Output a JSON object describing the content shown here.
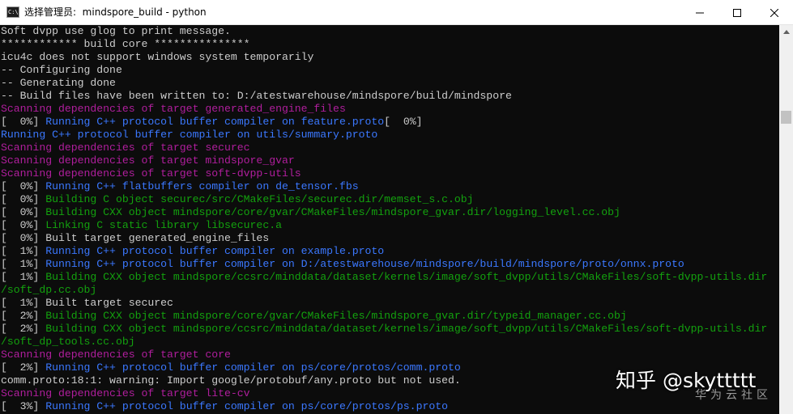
{
  "window": {
    "icon_text": "C:\\",
    "title": "选择管理员:  mindspore_build - python",
    "colors": {
      "background": "#0c0c0c",
      "titlebar": "#ffffff",
      "scrollbar": "#f0f0f0"
    }
  },
  "terminal": {
    "colors": {
      "white": "#cccccc",
      "magenta": "#b01e9d",
      "blue": "#3b78ff",
      "green": "#13a10e"
    },
    "lines": [
      {
        "segments": [
          {
            "text": "Soft dvpp use glog to print message.",
            "color": "white"
          }
        ]
      },
      {
        "segments": [
          {
            "text": "************ build core ***************",
            "color": "white"
          }
        ]
      },
      {
        "segments": [
          {
            "text": "icu4c does not support windows system temporarily",
            "color": "white"
          }
        ]
      },
      {
        "segments": [
          {
            "text": "-- Configuring done",
            "color": "white"
          }
        ]
      },
      {
        "segments": [
          {
            "text": "-- Generating done",
            "color": "white"
          }
        ]
      },
      {
        "segments": [
          {
            "text": "-- Build files have been written to: D:/atestwarehouse/mindspore/build/mindspore",
            "color": "white"
          }
        ]
      },
      {
        "segments": [
          {
            "text": "Scanning dependencies of target generated_engine_files",
            "color": "magenta"
          }
        ]
      },
      {
        "segments": [
          {
            "text": "[  0%] ",
            "color": "white"
          },
          {
            "text": "Running C++ protocol buffer compiler on feature.proto",
            "color": "blue"
          },
          {
            "text": "[  0%]",
            "color": "white"
          }
        ]
      },
      {
        "segments": [
          {
            "text": "Running C++ protocol buffer compiler on utils/summary.proto",
            "color": "blue"
          }
        ]
      },
      {
        "segments": [
          {
            "text": "Scanning dependencies of target securec",
            "color": "magenta"
          }
        ]
      },
      {
        "segments": [
          {
            "text": "Scanning dependencies of target mindspore_gvar",
            "color": "magenta"
          }
        ]
      },
      {
        "segments": [
          {
            "text": "Scanning dependencies of target soft-dvpp-utils",
            "color": "magenta"
          }
        ]
      },
      {
        "segments": [
          {
            "text": "[  0%] ",
            "color": "white"
          },
          {
            "text": "Running C++ flatbuffers compiler on de_tensor.fbs",
            "color": "blue"
          }
        ]
      },
      {
        "segments": [
          {
            "text": "[  0%] ",
            "color": "white"
          },
          {
            "text": "Building C object securec/src/CMakeFiles/securec.dir/memset_s.c.obj",
            "color": "green"
          }
        ]
      },
      {
        "segments": [
          {
            "text": "[  0%] ",
            "color": "white"
          },
          {
            "text": "Building CXX object mindspore/core/gvar/CMakeFiles/mindspore_gvar.dir/logging_level.cc.obj",
            "color": "green"
          }
        ]
      },
      {
        "segments": [
          {
            "text": "[  0%] ",
            "color": "white"
          },
          {
            "text": "Linking C static library libsecurec.a",
            "color": "green"
          }
        ]
      },
      {
        "segments": [
          {
            "text": "[  0%] Built target generated_engine_files",
            "color": "white"
          }
        ]
      },
      {
        "segments": [
          {
            "text": "[  1%] ",
            "color": "white"
          },
          {
            "text": "Running C++ protocol buffer compiler on example.proto",
            "color": "blue"
          }
        ]
      },
      {
        "segments": [
          {
            "text": "[  1%] ",
            "color": "white"
          },
          {
            "text": "Running C++ protocol buffer compiler on D:/atestwarehouse/mindspore/build/mindspore/proto/onnx.proto",
            "color": "blue"
          }
        ]
      },
      {
        "segments": [
          {
            "text": "[  1%] ",
            "color": "white"
          },
          {
            "text": "Building CXX object mindspore/ccsrc/minddata/dataset/kernels/image/soft_dvpp/utils/CMakeFiles/soft-dvpp-utils.dir",
            "color": "green"
          }
        ]
      },
      {
        "segments": [
          {
            "text": "/soft_dp.cc.obj",
            "color": "green"
          }
        ]
      },
      {
        "segments": [
          {
            "text": "[  1%] Built target securec",
            "color": "white"
          }
        ]
      },
      {
        "segments": [
          {
            "text": "[  2%] ",
            "color": "white"
          },
          {
            "text": "Building CXX object mindspore/core/gvar/CMakeFiles/mindspore_gvar.dir/typeid_manager.cc.obj",
            "color": "green"
          }
        ]
      },
      {
        "segments": [
          {
            "text": "[  2%] ",
            "color": "white"
          },
          {
            "text": "Building CXX object mindspore/ccsrc/minddata/dataset/kernels/image/soft_dvpp/utils/CMakeFiles/soft-dvpp-utils.dir",
            "color": "green"
          }
        ]
      },
      {
        "segments": [
          {
            "text": "/soft_dp_tools.cc.obj",
            "color": "green"
          }
        ]
      },
      {
        "segments": [
          {
            "text": "Scanning dependencies of target core",
            "color": "magenta"
          }
        ]
      },
      {
        "segments": [
          {
            "text": "[  2%] ",
            "color": "white"
          },
          {
            "text": "Running C++ protocol buffer compiler on ps/core/protos/comm.proto",
            "color": "blue"
          }
        ]
      },
      {
        "segments": [
          {
            "text": "comm.proto:18:1: warning: Import google/protobuf/any.proto but not used.",
            "color": "white"
          }
        ]
      },
      {
        "segments": [
          {
            "text": "Scanning dependencies of target lite-cv",
            "color": "magenta"
          }
        ]
      },
      {
        "segments": [
          {
            "text": "[  3%] ",
            "color": "white"
          },
          {
            "text": "Running C++ protocol buffer compiler on ps/core/protos/ps.proto",
            "color": "blue"
          }
        ]
      }
    ]
  },
  "watermark": {
    "main": "知乎 @skyttttt",
    "sub": "华为云社区"
  }
}
